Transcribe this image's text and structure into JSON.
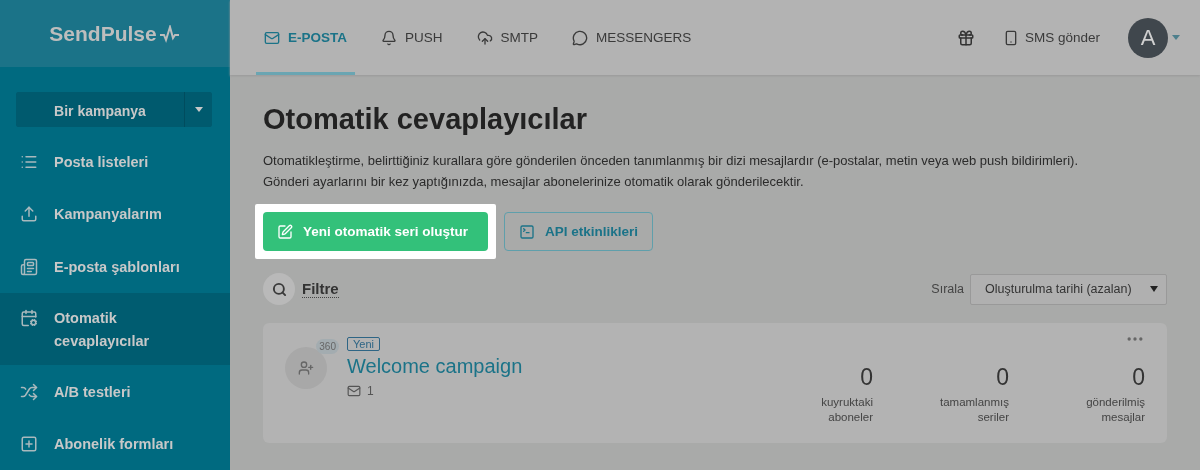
{
  "logo": "SendPulse",
  "sidebar": {
    "create_button": "Bir kampanya",
    "items": [
      {
        "label": "Posta listeleri",
        "selected": false
      },
      {
        "label": "Kampanyalarım",
        "selected": false
      },
      {
        "label": "E-posta şablonları",
        "selected": false
      },
      {
        "label": "Otomatik cevaplayıcılar",
        "selected": true
      },
      {
        "label": "A/B testleri",
        "selected": false
      },
      {
        "label": "Abonelik formları",
        "selected": false
      }
    ]
  },
  "tabs": [
    {
      "label": "E-POSTA",
      "selected": true
    },
    {
      "label": "PUSH",
      "selected": false
    },
    {
      "label": "SMTP",
      "selected": false
    },
    {
      "label": "MESSENGERS",
      "selected": false
    }
  ],
  "header_right": {
    "sms": "SMS gönder",
    "avatar": "A"
  },
  "page": {
    "title": "Otomatik cevaplayıcılar",
    "description": [
      "Otomatikleştirme, belirttiğiniz kurallara göre gönderilen önceden tanımlanmış bir dizi mesajlardır (e-postalar, metin veya web push bildirimleri).",
      "Gönderi ayarlarını bir kez yaptığınızda, mesajlar abonelerinize otomatik olarak gönderilecektir."
    ],
    "primary_button": "Yeni otomatik seri oluştur",
    "secondary_button": "API etkinlikleri",
    "filter": "Filtre",
    "sort_label": "Sırala",
    "sort_value": "Oluşturulma tarihi (azalan)"
  },
  "campaigns": [
    {
      "badge_count": "360",
      "status": "Yeni",
      "name": "Welcome campaign",
      "emails": "1",
      "stats": [
        {
          "value": "0",
          "label": "kuyruktaki aboneler"
        },
        {
          "value": "0",
          "label": "tamamlanmış seriler"
        },
        {
          "value": "0",
          "label": "gönderilmiş mesajlar"
        }
      ]
    }
  ]
}
